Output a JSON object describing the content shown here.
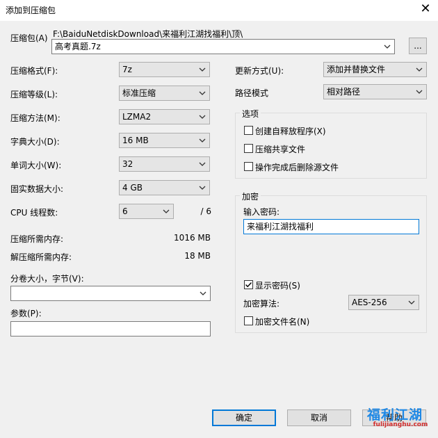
{
  "window": {
    "title": "添加到压缩包",
    "close_glyph": "✕"
  },
  "archive": {
    "label": "压缩包(A)",
    "path": "F:\\BaiduNetdiskDownload\\来福利江湖找福利\\顶\\",
    "filename": "高考真题.7z",
    "browse_label": "..."
  },
  "left": {
    "format": {
      "label": "压缩格式(F):",
      "value": "7z"
    },
    "level": {
      "label": "压缩等级(L):",
      "value": "标准压缩"
    },
    "method": {
      "label": "压缩方法(M):",
      "value": "LZMA2"
    },
    "dict": {
      "label": "字典大小(D):",
      "value": "16 MB"
    },
    "word": {
      "label": "单词大小(W):",
      "value": "32"
    },
    "solid": {
      "label": "固实数据大小:",
      "value": "4 GB"
    },
    "threads": {
      "label": "CPU 线程数:",
      "value": "6",
      "max": "/ 6"
    },
    "mem_compress": {
      "label": "压缩所需内存:",
      "value": "1016 MB"
    },
    "mem_decompress": {
      "label": "解压缩所需内存:",
      "value": "18 MB"
    },
    "volumes": {
      "label": "分卷大小，字节(V):",
      "value": ""
    },
    "params": {
      "label": "参数(P):",
      "value": ""
    }
  },
  "right": {
    "update": {
      "label": "更新方式(U):",
      "value": "添加并替换文件"
    },
    "pathmode": {
      "label": "路径模式",
      "value": "相对路径"
    },
    "options": {
      "title": "选项",
      "sfx": {
        "label": "创建自释放程序(X)",
        "checked": false
      },
      "shared": {
        "label": "压缩共享文件",
        "checked": false
      },
      "delete": {
        "label": "操作完成后删除源文件",
        "checked": false
      }
    },
    "encryption": {
      "title": "加密",
      "password_label": "输入密码:",
      "password_value": "来福利江湖找福利",
      "show_password": {
        "label": "显示密码(S)",
        "checked": true
      },
      "method_label": "加密算法:",
      "method_value": "AES-256",
      "encrypt_names": {
        "label": "加密文件名(N)",
        "checked": false
      }
    }
  },
  "buttons": {
    "ok": "确定",
    "cancel": "取消",
    "help": "帮助"
  },
  "watermark": {
    "text": "福利江湖",
    "url": "fulijianghu.com"
  },
  "colors": {
    "accent": "#0078d7",
    "watermark_blue": "#1e88e5",
    "watermark_red": "#d32f2f"
  }
}
